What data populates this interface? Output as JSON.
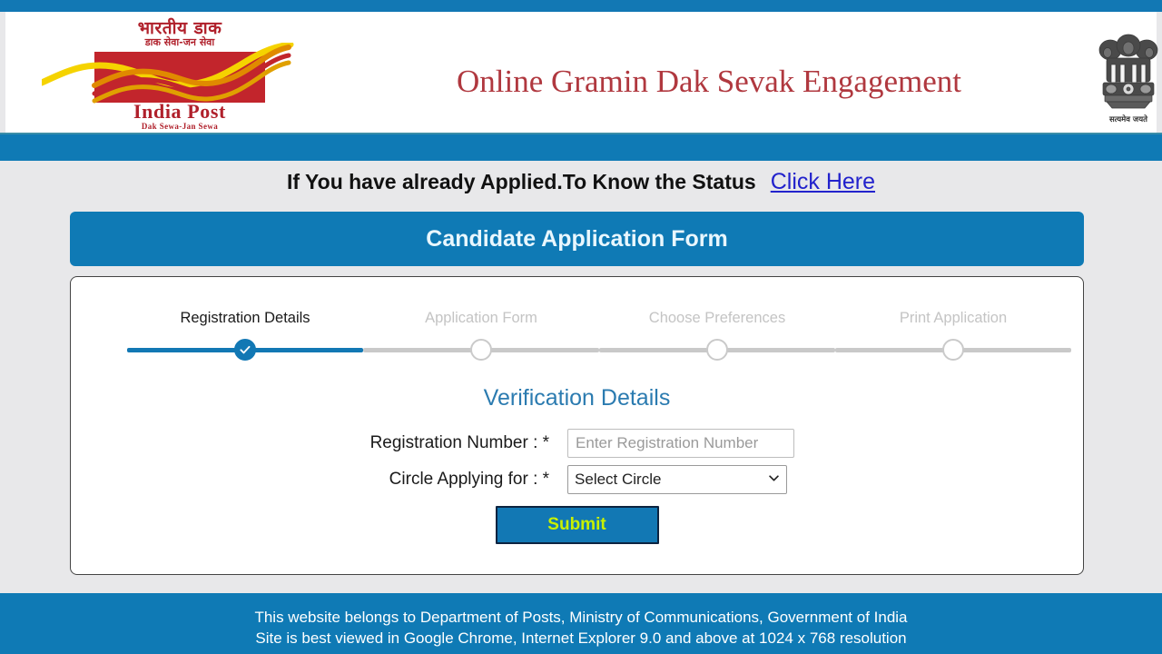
{
  "brand": {
    "logo": {
      "hindi_line1": "भारतीय डाक",
      "hindi_line2": "डाक सेवा-जन सेवा",
      "name": "India Post",
      "tagline": "Dak Sewa-Jan Sewa"
    },
    "emblem": {
      "motto": "सत्यमेव जयते",
      "icon": "ashoka-lion-capital-emblem"
    },
    "title": "Online Gramin Dak Sevak Engagement"
  },
  "colors": {
    "primary_blue": "#0f7ab5",
    "strip_blue": "#1278b4",
    "page_bg": "#e8e8ea",
    "logo_red": "#c2252c",
    "title_red": "#b0383f",
    "link_blue": "#2222cc",
    "section_blue": "#2b7bb0",
    "submit_text": "#c8f000",
    "submit_border": "#0c2340",
    "step_inactive": "#c9c9c9"
  },
  "status_banner": {
    "message": "If You have already Applied.To Know the Status",
    "link_label": "Click Here"
  },
  "form_header": {
    "title": "Candidate Application Form"
  },
  "stepper": {
    "steps": [
      {
        "label": "Registration Details",
        "state": "active"
      },
      {
        "label": "Application Form",
        "state": "inactive"
      },
      {
        "label": "Choose Preferences",
        "state": "inactive"
      },
      {
        "label": "Print Application",
        "state": "inactive"
      }
    ]
  },
  "form": {
    "section_title": "Verification Details",
    "fields": [
      {
        "label": "Registration Number : *",
        "type": "text",
        "value": "",
        "placeholder": "Enter Registration Number"
      },
      {
        "label": "Circle Applying for : *",
        "type": "select",
        "selected": "Select Circle",
        "chevron": "chevron-down-icon"
      }
    ],
    "submit_label": "Submit"
  },
  "footer": {
    "line1": "This website belongs to Department of Posts, Ministry of Communications, Government of India",
    "line2": "Site is best viewed in Google Chrome, Internet Explorer 9.0 and above at 1024 x 768 resolution"
  }
}
